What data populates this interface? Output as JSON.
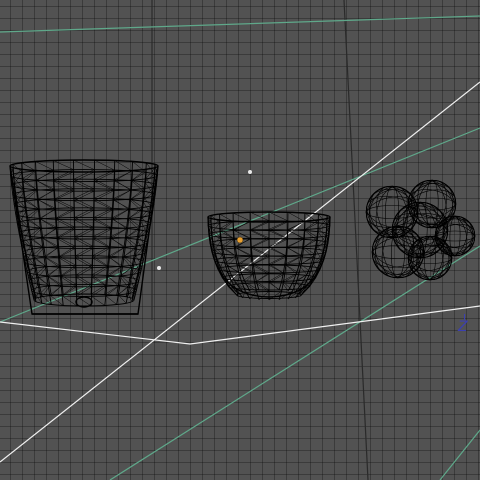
{
  "viewport": {
    "view_type": "3D wireframe viewport",
    "grid": "on",
    "axis_indicator": {
      "label": "Z",
      "color": "#3b3fb0"
    }
  },
  "objects": [
    {
      "name": "tall-cup-wireframe",
      "kind": "tumbler"
    },
    {
      "name": "bowl-wireframe",
      "kind": "bowl",
      "selected_origin_color": "#e8a030"
    },
    {
      "name": "lumpy-mesh-wireframe",
      "kind": "organic blob"
    }
  ],
  "colors": {
    "background": "#525252",
    "grid": "#3e3e3e",
    "wireframe": "#000000",
    "guide_line_white": "#f0f0f0",
    "guide_line_green": "#5fa88a",
    "lamp_point": "#e8e8e8",
    "origin_point": "#e8a030"
  }
}
